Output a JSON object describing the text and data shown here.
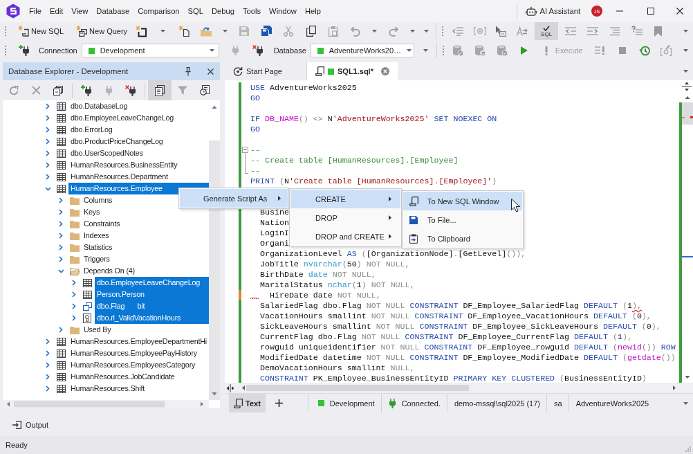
{
  "menubar": {
    "menus": [
      "File",
      "Edit",
      "View",
      "Database",
      "Comparison",
      "SQL",
      "Debug",
      "Tools",
      "Window",
      "Help"
    ],
    "assistant": "AI Assistant",
    "avatar_initials": "JS"
  },
  "toolbar": {
    "buttons": [
      {
        "label": "New SQL"
      },
      {
        "label": "New Query"
      }
    ],
    "sql_toggle": {
      "text": "SQL",
      "on": true
    }
  },
  "connection_bar": {
    "connection_label": "Connection",
    "connection_value": "Development",
    "database_label": "Database",
    "database_value": "AdventureWorks20…",
    "execute": {
      "label": "Execute",
      "disabled": true
    }
  },
  "explorer": {
    "title": "Database Explorer - Development",
    "toggle_on": true,
    "tree": [
      {
        "label": "dbo.DatabaseLog",
        "kind": "table",
        "expanded": false,
        "selected": false
      },
      {
        "label": "dbo.EmployeeLeaveChangeLog",
        "kind": "table",
        "expanded": false,
        "selected": false
      },
      {
        "label": "dbo.ErrorLog",
        "kind": "table",
        "expanded": false,
        "selected": false
      },
      {
        "label": "dbo.ProductPriceChangeLog",
        "kind": "table",
        "expanded": false,
        "selected": false
      },
      {
        "label": "dbo.UserScopedNotes",
        "kind": "table",
        "expanded": false,
        "selected": false
      },
      {
        "label": "HumanResources.BusinessEntity",
        "kind": "table",
        "expanded": false,
        "selected": false
      },
      {
        "label": "HumanResources.Department",
        "kind": "table",
        "expanded": false,
        "selected": false
      },
      {
        "label": "HumanResources.Employee",
        "kind": "table",
        "expanded": true,
        "selected": true,
        "children": [
          {
            "label": "Columns",
            "kind": "folder",
            "expanded": false,
            "selected": false
          },
          {
            "label": "Keys",
            "kind": "folder",
            "expanded": false,
            "selected": false
          },
          {
            "label": "Constraints",
            "kind": "folder",
            "expanded": false,
            "selected": false
          },
          {
            "label": "Indexes",
            "kind": "folder",
            "expanded": false,
            "selected": false
          },
          {
            "label": "Statistics",
            "kind": "folder",
            "expanded": false,
            "selected": false
          },
          {
            "label": "Triggers",
            "kind": "folder",
            "expanded": false,
            "selected": false
          },
          {
            "label": "Depends On (4)",
            "kind": "folder",
            "expanded": true,
            "selected": false,
            "children": [
              {
                "label": "dbo.EmployeeLeaveChangeLog",
                "kind": "table",
                "expanded": false,
                "selected": true
              },
              {
                "label": "Person.Person",
                "kind": "table",
                "expanded": false,
                "selected": true
              },
              {
                "label": "dbo.Flag",
                "detail": "bit",
                "kind": "type",
                "expanded": false,
                "selected": true
              },
              {
                "label": "dbo.rl_ValidVacationHours",
                "kind": "rule",
                "expanded": false,
                "selected": true
              }
            ]
          },
          {
            "label": "Used By",
            "kind": "folder",
            "expanded": false,
            "selected": false
          }
        ]
      },
      {
        "label": "HumanResources.EmployeeDepartmentHi",
        "kind": "table",
        "expanded": false,
        "selected": false
      },
      {
        "label": "HumanResources.EmployeePayHistory",
        "kind": "table",
        "expanded": false,
        "selected": false
      },
      {
        "label": "HumanResources.EmployeesCategory",
        "kind": "table",
        "expanded": false,
        "selected": false
      },
      {
        "label": "HumanResources.JobCandidate",
        "kind": "table",
        "expanded": false,
        "selected": false
      },
      {
        "label": "HumanResources.Shift",
        "kind": "table",
        "expanded": false,
        "selected": false
      }
    ]
  },
  "tabs": [
    {
      "label": "Start Page",
      "kind": "start",
      "selected": false
    },
    {
      "label": "SQL1.sql*",
      "kind": "sql",
      "selected": true
    }
  ],
  "editor": {
    "lines": [
      {
        "kind": "code",
        "unsaved": false,
        "tokens": [
          {
            "kind": "keyword",
            "text": "USE"
          },
          {
            "kind": "plain",
            "text": " AdventureWorks2025"
          }
        ]
      },
      {
        "kind": "code",
        "unsaved": false,
        "tokens": [
          {
            "kind": "keyword",
            "text": "GO"
          }
        ]
      },
      {
        "kind": "blank",
        "unsaved": false
      },
      {
        "kind": "code",
        "unsaved": false,
        "tokens": [
          {
            "kind": "keyword",
            "text": "IF "
          },
          {
            "kind": "function",
            "text": "DB_NAME"
          },
          {
            "kind": "muted",
            "text": "() <>"
          },
          {
            "kind": "plain",
            "text": " N"
          },
          {
            "kind": "string",
            "text": "'AdventureWorks2025'"
          },
          {
            "kind": "keyword",
            "text": " SET NOEXEC ON"
          }
        ]
      },
      {
        "kind": "code",
        "unsaved": false,
        "tokens": [
          {
            "kind": "keyword",
            "text": "GO"
          }
        ]
      },
      {
        "kind": "blank",
        "unsaved": false
      },
      {
        "kind": "fold_start",
        "unsaved": false,
        "tokens": [
          {
            "kind": "comment",
            "text": "--"
          }
        ]
      },
      {
        "kind": "fold_body",
        "unsaved": false,
        "tokens": [
          {
            "kind": "comment",
            "text": "-- Create table [HumanResources].[Employee]"
          }
        ]
      },
      {
        "kind": "fold_end",
        "unsaved": false,
        "tokens": [
          {
            "kind": "comment",
            "text": "--"
          }
        ]
      },
      {
        "kind": "code",
        "unsaved": false,
        "tokens": [
          {
            "kind": "keyword",
            "text": "PRINT "
          },
          {
            "kind": "muted",
            "text": "("
          },
          {
            "kind": "plain",
            "text": "N"
          },
          {
            "kind": "string",
            "text": "'Create table [HumanResources].[Employee]'"
          },
          {
            "kind": "muted",
            "text": ")"
          }
        ]
      },
      {
        "kind": "blank",
        "unsaved": false
      },
      {
        "kind": "blank"
      },
      {
        "kind": "code",
        "unsaved": false,
        "tokens": [
          {
            "kind": "plain",
            "text": "  Busine"
          }
        ]
      },
      {
        "kind": "code",
        "unsaved": false,
        "tokens": [
          {
            "kind": "plain",
            "text": "  Nation"
          }
        ]
      },
      {
        "kind": "code",
        "unsaved": false,
        "tokens": [
          {
            "kind": "plain",
            "text": "  LoginI"
          }
        ]
      },
      {
        "kind": "code",
        "unsaved": false,
        "tokens": [
          {
            "kind": "plain",
            "text": "  Organi"
          }
        ]
      },
      {
        "kind": "code",
        "unsaved": false,
        "tokens": [
          {
            "kind": "plain",
            "text": "  OrganizationLevel "
          },
          {
            "kind": "keyword",
            "text": "AS"
          },
          {
            "kind": "muted",
            "text": " ("
          },
          {
            "kind": "plain",
            "text": "[OrganizationNode]"
          },
          {
            "kind": "muted",
            "text": "."
          },
          {
            "kind": "plain",
            "text": "[GetLevel]"
          },
          {
            "kind": "muted",
            "text": "()),"
          }
        ]
      },
      {
        "kind": "code",
        "unsaved": false,
        "tokens": [
          {
            "kind": "plain",
            "text": "  JobTitle "
          },
          {
            "kind": "type",
            "text": "nvarchar"
          },
          {
            "kind": "muted",
            "text": "("
          },
          {
            "kind": "plain",
            "text": "50"
          },
          {
            "kind": "muted",
            "text": ") NOT NULL,"
          }
        ]
      },
      {
        "kind": "code",
        "unsaved": false,
        "tokens": [
          {
            "kind": "plain",
            "text": "  BirthDate "
          },
          {
            "kind": "type",
            "text": "date"
          },
          {
            "kind": "muted",
            "text": " NOT NULL,"
          }
        ]
      },
      {
        "kind": "code",
        "unsaved": false,
        "tokens": [
          {
            "kind": "plain",
            "text": "  MaritalStatus "
          },
          {
            "kind": "type",
            "text": "nchar"
          },
          {
            "kind": "muted",
            "text": "("
          },
          {
            "kind": "plain",
            "text": "1"
          },
          {
            "kind": "muted",
            "text": ") NOT NULL,"
          }
        ]
      },
      {
        "kind": "error",
        "unsaved": true,
        "tokens": [
          {
            "kind": "plain",
            "text": "    HireDate date "
          },
          {
            "kind": "muted",
            "text": "NOT NULL,"
          }
        ]
      },
      {
        "kind": "code",
        "unsaved": false,
        "tokens": [
          {
            "kind": "plain",
            "text": "  SalariedFlag dbo.Flag "
          },
          {
            "kind": "muted",
            "text": "NOT NULL "
          },
          {
            "kind": "keyword",
            "text": "CONSTRAINT"
          },
          {
            "kind": "plain",
            "text": " DF_Employee_SalariedFlag "
          },
          {
            "kind": "keyword",
            "text": "DEFAULT"
          },
          {
            "kind": "muted",
            "text": " ("
          },
          {
            "kind": "plain",
            "text": "1"
          },
          {
            "kind": "error",
            "text": "),"
          }
        ]
      },
      {
        "kind": "code",
        "unsaved": false,
        "tokens": [
          {
            "kind": "plain",
            "text": "  VacationHours smallint "
          },
          {
            "kind": "muted",
            "text": "NOT NULL "
          },
          {
            "kind": "keyword",
            "text": "CONSTRAINT"
          },
          {
            "kind": "plain",
            "text": " DF_Employee_VacationHours "
          },
          {
            "kind": "keyword",
            "text": "DEFAULT"
          },
          {
            "kind": "muted",
            "text": " ("
          },
          {
            "kind": "plain",
            "text": "0"
          },
          {
            "kind": "muted",
            "text": "),"
          }
        ]
      },
      {
        "kind": "code",
        "unsaved": false,
        "tokens": [
          {
            "kind": "plain",
            "text": "  SickLeaveHours smallint "
          },
          {
            "kind": "muted",
            "text": "NOT NULL "
          },
          {
            "kind": "keyword",
            "text": "CONSTRAINT"
          },
          {
            "kind": "plain",
            "text": " DF_Employee_SickLeaveHours "
          },
          {
            "kind": "keyword",
            "text": "DEFAULT"
          },
          {
            "kind": "muted",
            "text": " ("
          },
          {
            "kind": "plain",
            "text": "0"
          },
          {
            "kind": "muted",
            "text": "),"
          }
        ]
      },
      {
        "kind": "code",
        "unsaved": false,
        "tokens": [
          {
            "kind": "plain",
            "text": "  CurrentFlag dbo.Flag "
          },
          {
            "kind": "muted",
            "text": "NOT NULL "
          },
          {
            "kind": "keyword",
            "text": "CONSTRAINT"
          },
          {
            "kind": "plain",
            "text": " DF_Employee_CurrentFlag "
          },
          {
            "kind": "keyword",
            "text": "DEFAULT"
          },
          {
            "kind": "muted",
            "text": " ("
          },
          {
            "kind": "plain",
            "text": "1"
          },
          {
            "kind": "muted",
            "text": "),"
          }
        ]
      },
      {
        "kind": "code",
        "unsaved": false,
        "tokens": [
          {
            "kind": "plain",
            "text": "  rowguid uniqueidentifier "
          },
          {
            "kind": "muted",
            "text": "NOT NULL "
          },
          {
            "kind": "keyword",
            "text": "CONSTRAINT"
          },
          {
            "kind": "plain",
            "text": " DF_Employee_rowguid "
          },
          {
            "kind": "keyword",
            "text": "DEFAULT"
          },
          {
            "kind": "muted",
            "text": " ("
          },
          {
            "kind": "function",
            "text": "newid"
          },
          {
            "kind": "muted",
            "text": "())"
          },
          {
            "kind": "keyword",
            "text": " ROW"
          }
        ]
      },
      {
        "kind": "code",
        "unsaved": false,
        "tokens": [
          {
            "kind": "plain",
            "text": "  ModifiedDate datetime "
          },
          {
            "kind": "muted",
            "text": "NOT NULL "
          },
          {
            "kind": "keyword",
            "text": "CONSTRAINT"
          },
          {
            "kind": "plain",
            "text": " DF_Employee_ModifiedDate "
          },
          {
            "kind": "keyword",
            "text": "DEFAULT"
          },
          {
            "kind": "muted",
            "text": " ("
          },
          {
            "kind": "function",
            "text": "getdate"
          },
          {
            "kind": "muted",
            "text": "())"
          }
        ]
      },
      {
        "kind": "code",
        "unsaved": false,
        "tokens": [
          {
            "kind": "plain",
            "text": "  DemoVacationHours smallint "
          },
          {
            "kind": "muted",
            "text": "NULL,"
          }
        ]
      },
      {
        "kind": "code",
        "unsaved": false,
        "tokens": [
          {
            "kind": "keyword",
            "text": "  CONSTRAINT"
          },
          {
            "kind": "plain",
            "text": " PK_Employee_BusinessEntityID "
          },
          {
            "kind": "keyword",
            "text": "PRIMARY KEY CLUSTERED"
          },
          {
            "kind": "muted",
            "text": " ("
          },
          {
            "kind": "plain",
            "text": "BusinessEntityID"
          },
          {
            "kind": "muted",
            "text": ")"
          }
        ]
      }
    ]
  },
  "editor_status": {
    "views": [
      {
        "label": "Text",
        "selected": true
      }
    ],
    "items": [
      {
        "kind": "environment",
        "text": "Development"
      },
      {
        "kind": "connection",
        "text": "Connected."
      },
      {
        "kind": "plain",
        "text": "demo-mssql\\sql2025 (17)"
      },
      {
        "kind": "plain",
        "text": "sa"
      },
      {
        "kind": "plain",
        "text": "AdventureWorks2025"
      }
    ]
  },
  "context_menus": [
    {
      "items": [
        {
          "label": "Generate Script As",
          "selected": true,
          "submenu": true
        }
      ]
    },
    {
      "items": [
        {
          "label": "CREATE",
          "selected": true,
          "submenu": true
        },
        {
          "label": "DROP",
          "selected": false,
          "submenu": true
        },
        {
          "label": "DROP and CREATE",
          "selected": false,
          "submenu": true
        }
      ]
    },
    {
      "items": [
        {
          "label": "To New SQL Window",
          "selected": true,
          "submenu": false
        },
        {
          "label": "To File...",
          "selected": false,
          "submenu": false
        },
        {
          "label": "To Clipboard",
          "selected": false,
          "submenu": false
        }
      ]
    }
  ],
  "output_panel": {
    "label": "Output"
  },
  "status_bar": {
    "text": "Ready"
  }
}
